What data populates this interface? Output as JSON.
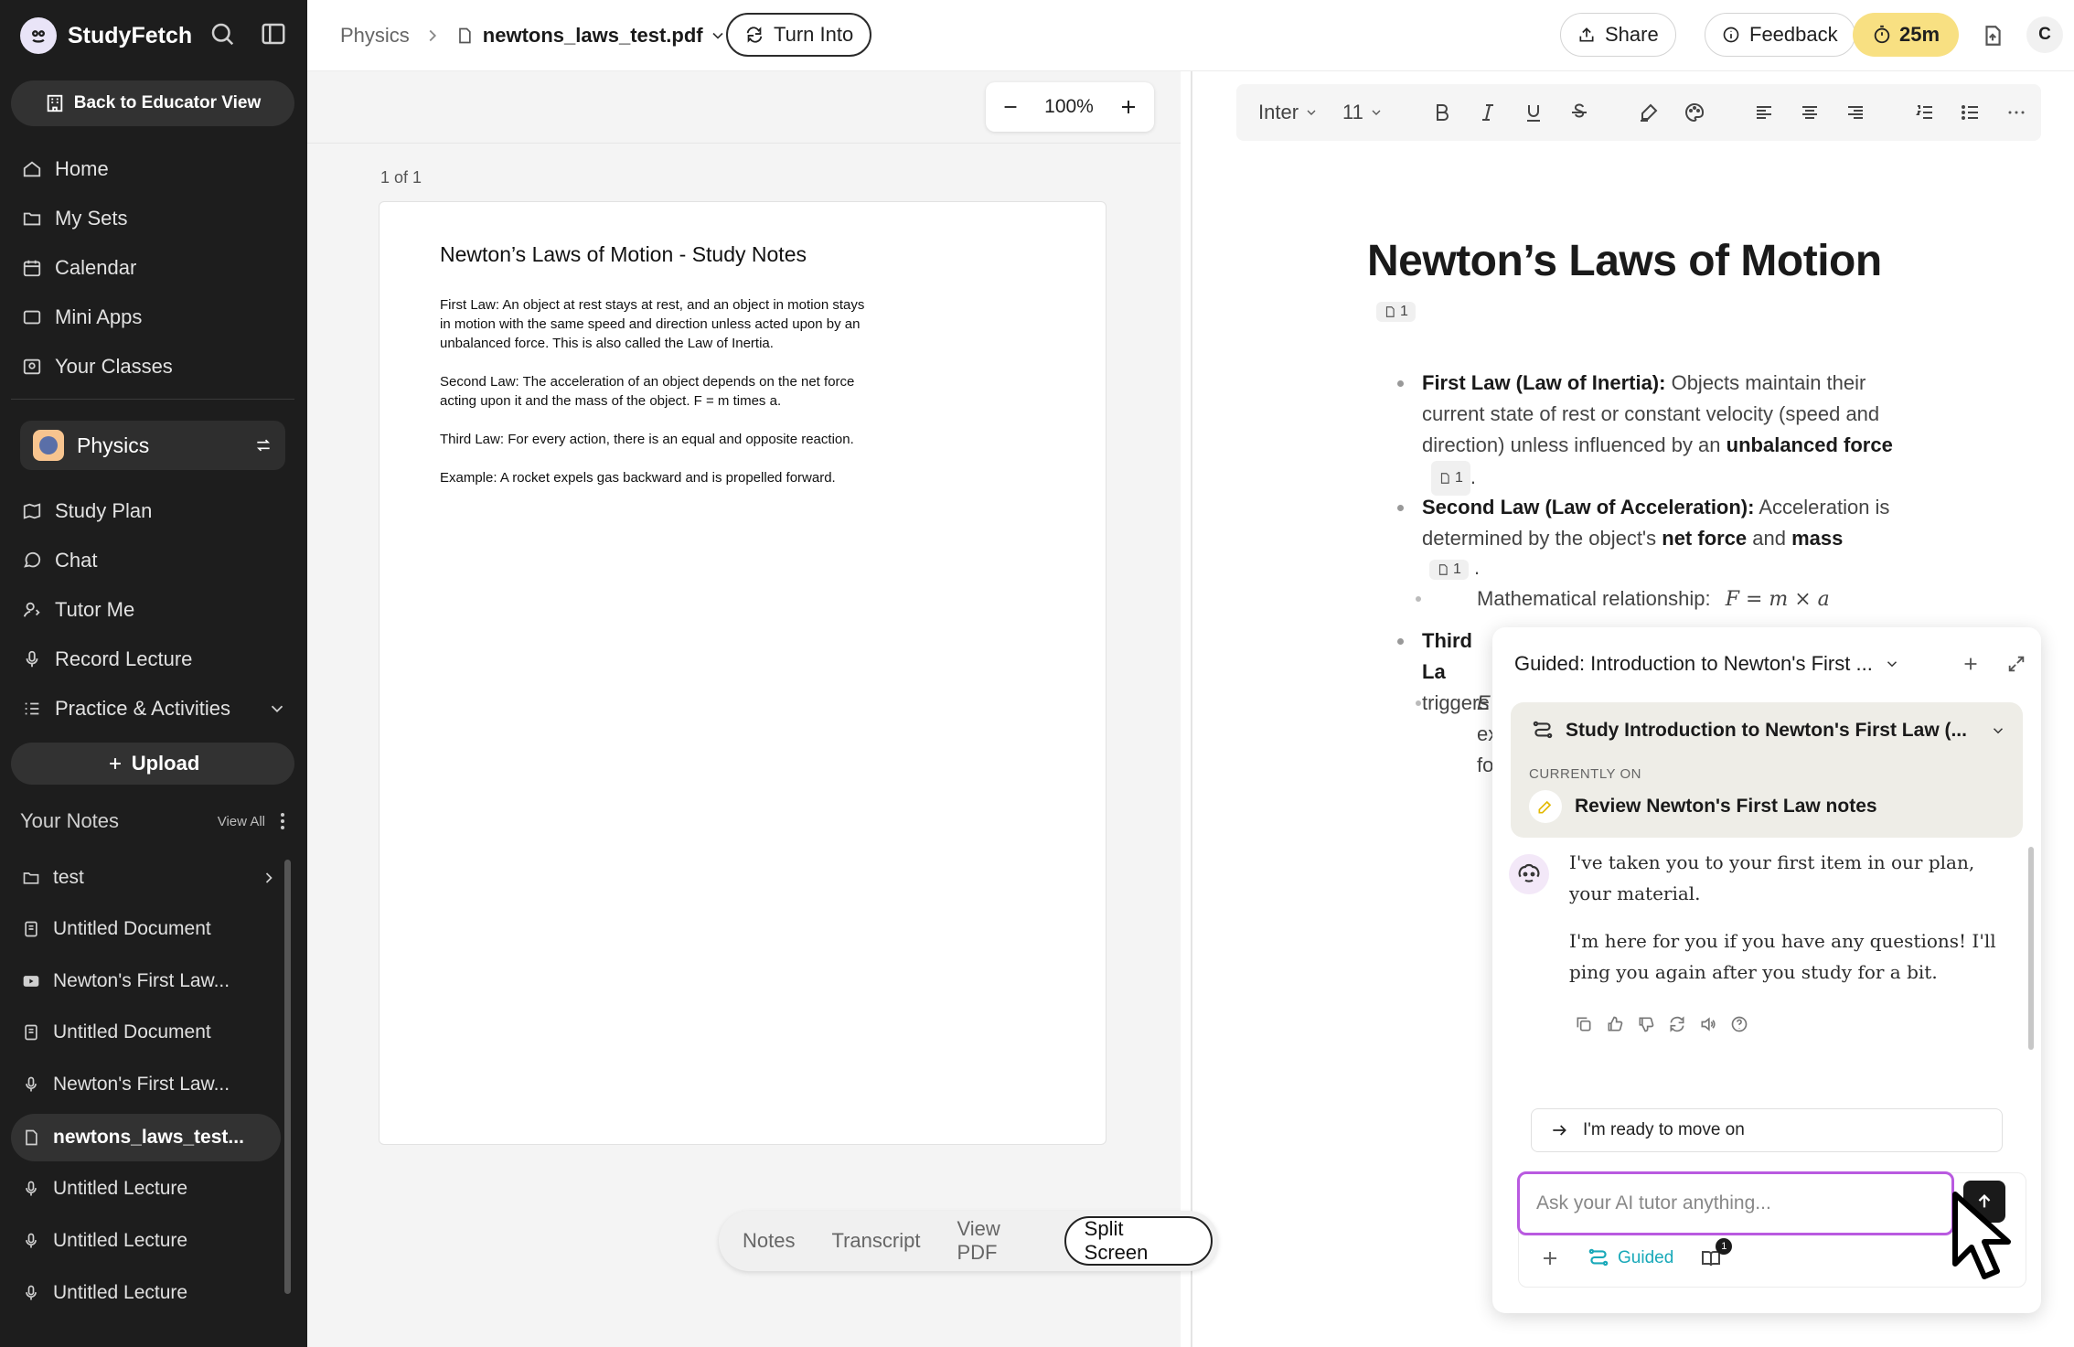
{
  "sidebar": {
    "brand": "StudyFetch",
    "educator_btn": "Back to Educator View",
    "nav": [
      "Home",
      "My Sets",
      "Calendar",
      "Mini Apps",
      "Your Classes"
    ],
    "class_name": "Physics",
    "class_nav": [
      "Study Plan",
      "Chat",
      "Tutor Me",
      "Record Lecture",
      "Practice & Activities"
    ],
    "upload_label": "Upload",
    "notes_title": "Your Notes",
    "view_all": "View All",
    "notes": [
      {
        "label": "test",
        "icon": "folder-icon"
      },
      {
        "label": "Untitled Document",
        "icon": "document-icon"
      },
      {
        "label": "Newton's First Law...",
        "icon": "video-icon"
      },
      {
        "label": "Untitled Document",
        "icon": "document-icon"
      },
      {
        "label": "Newton's First Law...",
        "icon": "microphone-icon"
      },
      {
        "label": "newtons_laws_test...",
        "icon": "pdf-icon"
      },
      {
        "label": "Untitled Lecture",
        "icon": "microphone-icon"
      },
      {
        "label": "Untitled Lecture",
        "icon": "microphone-icon"
      },
      {
        "label": "Untitled Lecture",
        "icon": "microphone-icon"
      }
    ]
  },
  "topbar": {
    "crumb_root": "Physics",
    "file_name": "newtons_laws_test.pdf",
    "turn_into": "Turn Into",
    "share": "Share",
    "feedback": "Feedback",
    "timer": "25m",
    "avatar": "C"
  },
  "pdf": {
    "zoom": "100%",
    "page_count": "1 of 1",
    "title": "Newton’s Laws of Motion - Study Notes",
    "paragraphs": [
      "First Law: An object at rest stays at rest, and an object in motion stays in motion with the same speed and direction unless acted upon by an unbalanced force. This is also called the Law of Inertia.",
      "Second Law: The acceleration of an object depends on the net force acting upon it and the mass of the object. F = m times a.",
      "Third Law: For every action, there is an equal and opposite reaction.",
      "Example: A rocket expels gas backward and is propelled forward."
    ]
  },
  "view_tabs": [
    "Notes",
    "Transcript",
    "View PDF",
    "Split Screen"
  ],
  "editor": {
    "font": "Inter",
    "size": "11",
    "title": "Newton’s Laws of Motion",
    "cite": "1",
    "b1_label": "First Law (Law of Inertia):",
    "b1_text": " Objects maintain their current state of rest or constant velocity (speed and direction) unless influenced by an ",
    "b1_strong": "unbalanced force",
    "b2_label": "Second Law (Law of Acceleration):",
    "b2_text": " Acceleration is determined by the object's ",
    "b2_strong1": "net force",
    "b2_and": " and ",
    "b2_strong2": "mass",
    "sub_label": "Mathematical relationship:",
    "formula": "F = m × a",
    "b3_partial": "Third La",
    "b3_line2": "triggers",
    "b3_sub1": "E",
    "b3_sub2": "ex",
    "b3_sub3": "fo"
  },
  "chat": {
    "header": "Guided: Introduction to Newton's First ...",
    "plan_title": "Study Introduction to Newton's First Law (...",
    "currently_on": "CURRENTLY ON",
    "plan_item": "Review Newton's First Law notes",
    "msg1": "I've taken you to your first item in our plan, your material.",
    "msg2": "I'm here for you if you have any questions! I'll ping you again after you study for a bit.",
    "ready": "I'm ready to move on",
    "placeholder": "Ask your AI tutor anything...",
    "guided": "Guided",
    "badge": "1"
  }
}
